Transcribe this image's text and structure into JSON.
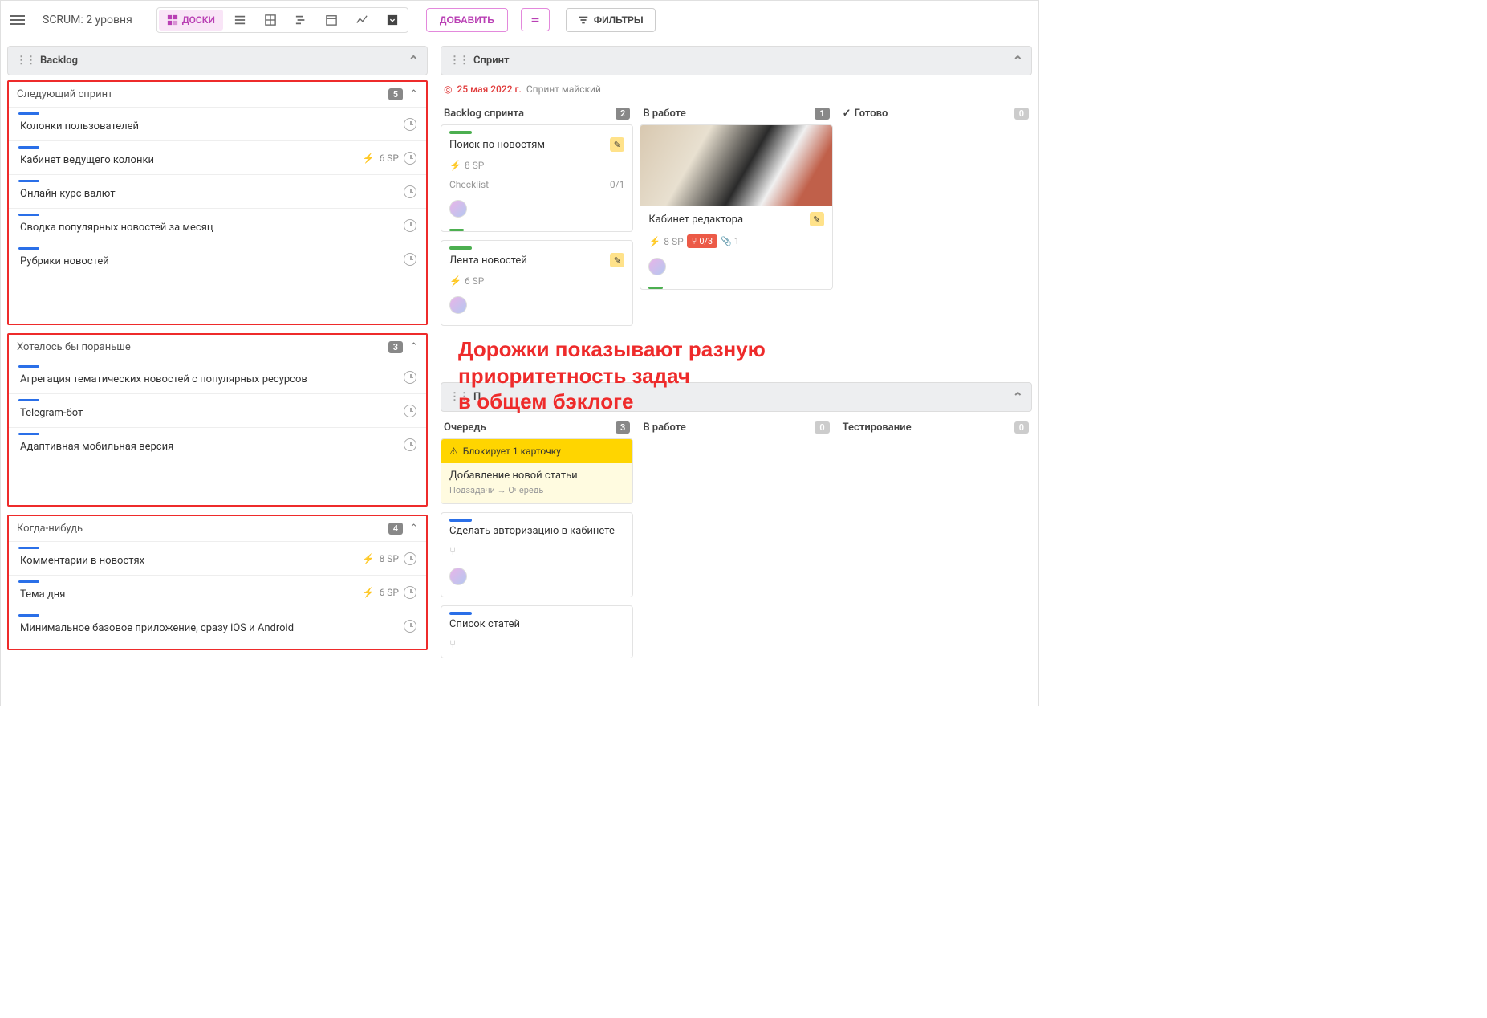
{
  "toolbar": {
    "title": "SCRUM: 2 уровня",
    "views": {
      "boards": "ДОСКИ"
    },
    "add_button": "ДОБАВИТЬ",
    "filter_button": "ФИЛЬТРЫ"
  },
  "backlog": {
    "title": "Backlog",
    "groups": [
      {
        "name": "Следующий спринт",
        "count": "5",
        "items": [
          {
            "title": "Колонки пользователей",
            "sp": ""
          },
          {
            "title": "Кабинет ведущего колонки",
            "sp": "6 SP"
          },
          {
            "title": "Онлайн курс валют",
            "sp": ""
          },
          {
            "title": "Сводка популярных новостей за месяц",
            "sp": ""
          },
          {
            "title": "Рубрики новостей",
            "sp": ""
          }
        ]
      },
      {
        "name": "Хотелось бы пораньше",
        "count": "3",
        "items": [
          {
            "title": "Агрегация тематических новостей с популярных ресурсов",
            "sp": ""
          },
          {
            "title": "Telegram-бот",
            "sp": ""
          },
          {
            "title": "Адаптивная мобильная версия",
            "sp": ""
          }
        ]
      },
      {
        "name": "Когда-нибудь",
        "count": "4",
        "items": [
          {
            "title": "Комментарии в новостях",
            "sp": "8 SP"
          },
          {
            "title": "Тема дня",
            "sp": "6 SP"
          },
          {
            "title": "Минимальное базовое приложение, сразу iOS и Android",
            "sp": ""
          }
        ]
      }
    ]
  },
  "sprint": {
    "title": "Спринт",
    "date": "25 мая 2022 г.",
    "name": "Спринт майский",
    "columns": {
      "backlog": {
        "title": "Backlog спринта",
        "count": "2"
      },
      "in_work": {
        "title": "В работе",
        "count": "1"
      },
      "done": {
        "title": "Готово",
        "count": "0"
      }
    },
    "cards": {
      "c1": {
        "title": "Поиск по новостям",
        "sp": "8 SP",
        "checklist_label": "Checklist",
        "checklist": "0/1"
      },
      "c2": {
        "title": "Лента новостей",
        "sp": "6 SP"
      },
      "c3": {
        "title": "Кабинет редактора",
        "sp": "8 SP",
        "subtasks": "0/3",
        "attach": "1"
      }
    }
  },
  "pipeline": {
    "title_prefix": "П",
    "columns": {
      "queue": {
        "title": "Очередь",
        "count": "3"
      },
      "in_work": {
        "title": "В работе",
        "count": "0"
      },
      "testing": {
        "title": "Тестирование",
        "count": "0"
      }
    },
    "cards": {
      "b1": {
        "block_label": "Блокирует 1 карточку",
        "title": "Добавление новой статьи",
        "subtitle": "Подзадачи → Очередь"
      },
      "b2": {
        "title": "Сделать авторизацию в кабинете"
      },
      "b3": {
        "title": "Список статей"
      }
    }
  },
  "annotation": {
    "line1": "Дорожки показывают разную",
    "line2": "приоритетность задач",
    "line3": "в общем бэклоге"
  }
}
